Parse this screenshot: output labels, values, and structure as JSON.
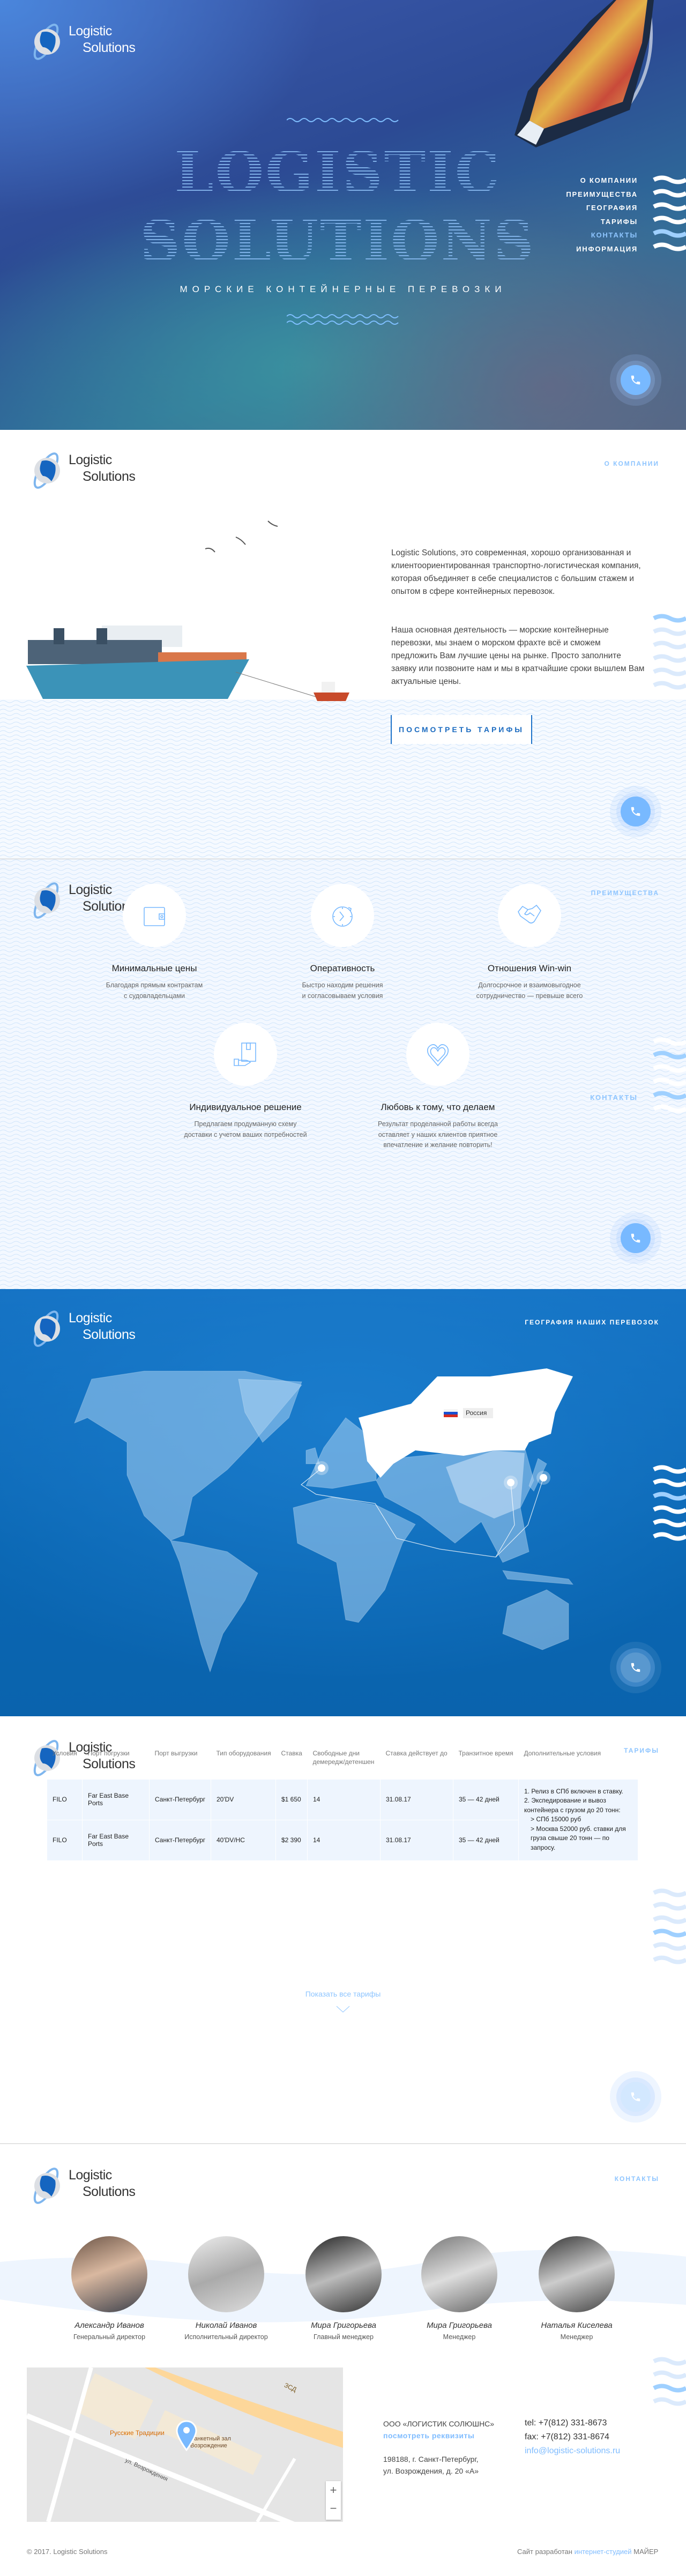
{
  "brand": {
    "line1": "Logistic",
    "line2": "Solutions"
  },
  "hero": {
    "title_line1": "LOGISTIC",
    "title_line2": "SOLUTIONS",
    "subtitle": "МОРСКИЕ КОНТЕЙНЕРНЫЕ ПЕРЕВОЗКИ"
  },
  "nav": {
    "items": [
      "О КОМПАНИИ",
      "ПРЕИМУЩЕСТВА",
      "ГЕОГРАФИЯ",
      "ТАРИФЫ",
      "КОНТАКТЫ",
      "ИНФОРМАЦИЯ"
    ],
    "active_index": 4
  },
  "colors": {
    "accent": "#8ec5ff",
    "button_blue": "#1b6bc0",
    "call_button": "#78b9ff",
    "sea": "#0a66b2"
  },
  "about": {
    "label": "О КОМПАНИИ",
    "paragraph1": "Logistic Solutions, это современная, хорошо организованная и клиентоориентированная транспортно-логистическая компания, которая объединяет в себе специалистов с большим стажем и опытом в сфере контейнерных перевозок.",
    "paragraph2": "Наша основная деятельность — морские контейнерные перевозки, мы знаем о морском фрахте всё и сможем предложить Вам лучшие цены на рынке. Просто заполните заявку или позвоните нам и мы в кратчайшие сроки вышлем Вам актуальные цены.",
    "button": "ПОСМОТРЕТЬ ТАРИФЫ"
  },
  "advantages": {
    "label": "ПРЕИМУЩЕСТВА",
    "side_label": "КОНТАКТЫ",
    "items": [
      {
        "icon": "wallet-icon",
        "title": "Минимальные цены",
        "desc": [
          "Благодаря прямым контрактам",
          "с судовладельцами"
        ]
      },
      {
        "icon": "clock-icon",
        "title": "Оперативность",
        "desc": [
          "Быстро находим решения",
          "и согласовываем условия"
        ]
      },
      {
        "icon": "handshake-icon",
        "title": "Отношения Win-win",
        "desc": [
          "Долгосрочное и взаимовыгодное",
          "сотрудничество — превыше всего"
        ]
      },
      {
        "icon": "box-hand-icon",
        "title": "Индивидуальное решение",
        "desc": [
          "Предлагаем продуманную схему",
          "доставки с учетом ваших потребностей"
        ]
      },
      {
        "icon": "heart-icon",
        "title": "Любовь к тому, что делаем",
        "desc": [
          "Результат проделанной работы всегда",
          "оставляет у наших клиентов приятное",
          "впечатление и желание повторить!"
        ]
      }
    ]
  },
  "geography": {
    "label": "ГЕОГРАФИЯ НАШИХ ПЕРЕВОЗОК",
    "highlight_country": "Россия"
  },
  "tariffs": {
    "label": "ТАРИФЫ",
    "headers": [
      "Условия",
      "Порт погрузки",
      "Порт выгрузки",
      "Тип оборудования",
      "Ставка",
      "Свободные дни демередж/детеншен",
      "Ставка действует до",
      "Транзитное время",
      "Дополнительные условия"
    ],
    "rows": [
      [
        "FILO",
        "Far East Base Ports",
        "Санкт-Петербург",
        "20'DV",
        "$1 650",
        "14",
        "31.08.17",
        "35 — 42 дней"
      ],
      [
        "FILO",
        "Far East Base Ports",
        "Санкт-Петербург",
        "40'DV/HC",
        "$2 390",
        "14",
        "31.08.17",
        "35 — 42 дней"
      ]
    ],
    "extra": [
      "1. Релиз в СПб включен в ставку.",
      "2. Экспедирование и вывоз контейнера с грузом до 20 тонн:",
      "> СПб 15000 руб",
      "> Москва 52000 руб. ставки для груза свыше 20 тонн — по запросу."
    ],
    "show_all": "Показать все тарифы"
  },
  "contacts": {
    "label": "КОНТАКТЫ",
    "team": [
      {
        "name": "Александр Иванов",
        "role": "Генеральный директор"
      },
      {
        "name": "Николай Иванов",
        "role": "Исполнительный директор"
      },
      {
        "name": "Мира Григорьева",
        "role": "Главный менеджер"
      },
      {
        "name": "Мира Григорьева",
        "role": "Менеджер"
      },
      {
        "name": "Наталья Киселева",
        "role": "Менеджер"
      }
    ],
    "company": "ООО «ЛОГИСТИК СОЛЮШНС»",
    "requisites_link": "посмотреть реквизиты",
    "address1": "198188, г. Санкт-Петербург,",
    "address2": "ул. Возрождения, д. 20 «А»",
    "tel": "tel: +7(812) 331-8673",
    "fax": "fax: +7(812) 331-8674",
    "email": "info@logistic-solutions.ru",
    "map_labels": {
      "cafe": "Русские Традиции",
      "venue": "Банкетный зал Возрождение",
      "street": "ул. Возрождения",
      "road": "ЗСД",
      "zoom_in": "+",
      "zoom_out": "−"
    },
    "copyright": "© 2017. Logistic Solutions",
    "credit_prefix": "Сайт разработан",
    "credit_link": "интернет-студией",
    "credit_suffix": "МАЙЕР"
  }
}
